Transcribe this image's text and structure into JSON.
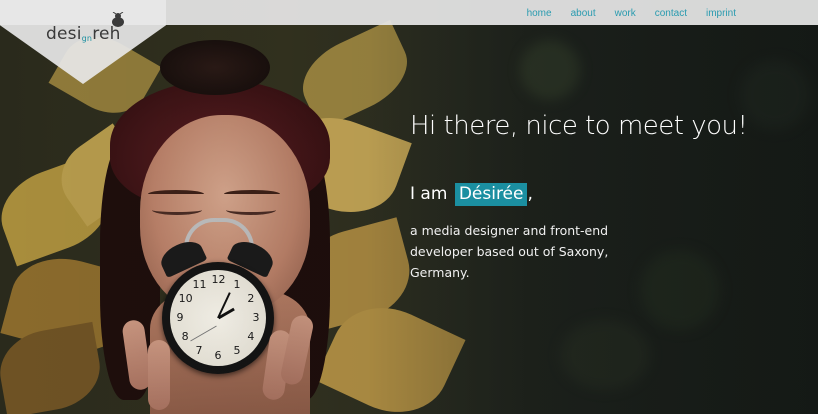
{
  "logo": {
    "prefix": "desi",
    "small": "gn",
    "suffix": "reh"
  },
  "nav": {
    "items": [
      {
        "id": "home",
        "label": "home"
      },
      {
        "id": "about",
        "label": "about"
      },
      {
        "id": "work",
        "label": "work"
      },
      {
        "id": "contact",
        "label": "contact"
      },
      {
        "id": "imprint",
        "label": "imprint"
      }
    ],
    "link_color": "#2a9bb0"
  },
  "hero": {
    "headline": "Hi there, nice to meet you!",
    "intro_prefix": "I am",
    "name": "Désirée",
    "intro_suffix": ",",
    "tagline": "a media designer and front-end developer based out of Saxony, Germany.",
    "accent_color": "#1b8fa1"
  },
  "clock": {
    "numerals": [
      "12",
      "1",
      "2",
      "3",
      "4",
      "5",
      "6",
      "7",
      "8",
      "9",
      "10",
      "11"
    ]
  }
}
